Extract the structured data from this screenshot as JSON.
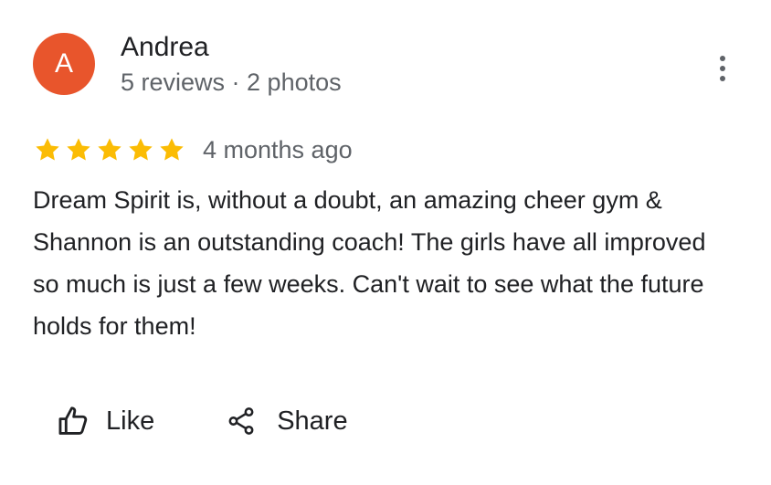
{
  "reviewer": {
    "initial": "A",
    "name": "Andrea",
    "meta": "5 reviews · 2 photos",
    "avatar_color": "#e8552c"
  },
  "rating": {
    "stars": 5,
    "max_stars": 5,
    "time_ago": "4 months ago",
    "star_color": "#fbbc04"
  },
  "review": {
    "text": "Dream Spirit is, without a doubt, an amazing cheer gym & Shannon is an outstanding coach! The girls have all improved so much is just a few weeks. Can't wait to see what the future holds for them!"
  },
  "actions": {
    "like_label": "Like",
    "share_label": "Share"
  },
  "icons": {
    "like": "thumbs-up-icon",
    "share": "share-icon",
    "more": "more-vert-icon",
    "star": "star-icon"
  }
}
